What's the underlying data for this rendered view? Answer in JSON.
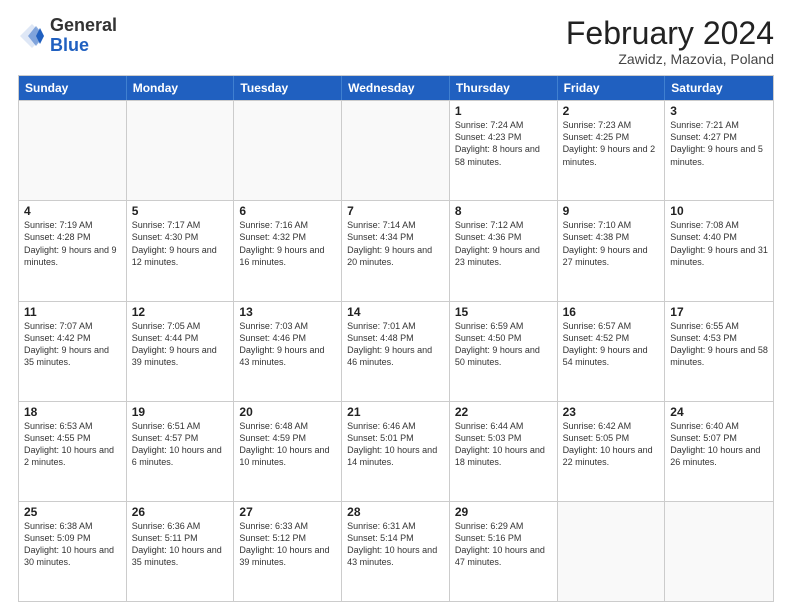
{
  "header": {
    "logo_general": "General",
    "logo_blue": "Blue",
    "title": "February 2024",
    "subtitle": "Zawidz, Mazovia, Poland"
  },
  "calendar": {
    "weekdays": [
      "Sunday",
      "Monday",
      "Tuesday",
      "Wednesday",
      "Thursday",
      "Friday",
      "Saturday"
    ],
    "rows": [
      [
        {
          "day": "",
          "empty": true
        },
        {
          "day": "",
          "empty": true
        },
        {
          "day": "",
          "empty": true
        },
        {
          "day": "",
          "empty": true
        },
        {
          "day": "1",
          "info": "Sunrise: 7:24 AM\nSunset: 4:23 PM\nDaylight: 8 hours\nand 58 minutes."
        },
        {
          "day": "2",
          "info": "Sunrise: 7:23 AM\nSunset: 4:25 PM\nDaylight: 9 hours\nand 2 minutes."
        },
        {
          "day": "3",
          "info": "Sunrise: 7:21 AM\nSunset: 4:27 PM\nDaylight: 9 hours\nand 5 minutes."
        }
      ],
      [
        {
          "day": "4",
          "info": "Sunrise: 7:19 AM\nSunset: 4:28 PM\nDaylight: 9 hours\nand 9 minutes."
        },
        {
          "day": "5",
          "info": "Sunrise: 7:17 AM\nSunset: 4:30 PM\nDaylight: 9 hours\nand 12 minutes."
        },
        {
          "day": "6",
          "info": "Sunrise: 7:16 AM\nSunset: 4:32 PM\nDaylight: 9 hours\nand 16 minutes."
        },
        {
          "day": "7",
          "info": "Sunrise: 7:14 AM\nSunset: 4:34 PM\nDaylight: 9 hours\nand 20 minutes."
        },
        {
          "day": "8",
          "info": "Sunrise: 7:12 AM\nSunset: 4:36 PM\nDaylight: 9 hours\nand 23 minutes."
        },
        {
          "day": "9",
          "info": "Sunrise: 7:10 AM\nSunset: 4:38 PM\nDaylight: 9 hours\nand 27 minutes."
        },
        {
          "day": "10",
          "info": "Sunrise: 7:08 AM\nSunset: 4:40 PM\nDaylight: 9 hours\nand 31 minutes."
        }
      ],
      [
        {
          "day": "11",
          "info": "Sunrise: 7:07 AM\nSunset: 4:42 PM\nDaylight: 9 hours\nand 35 minutes."
        },
        {
          "day": "12",
          "info": "Sunrise: 7:05 AM\nSunset: 4:44 PM\nDaylight: 9 hours\nand 39 minutes."
        },
        {
          "day": "13",
          "info": "Sunrise: 7:03 AM\nSunset: 4:46 PM\nDaylight: 9 hours\nand 43 minutes."
        },
        {
          "day": "14",
          "info": "Sunrise: 7:01 AM\nSunset: 4:48 PM\nDaylight: 9 hours\nand 46 minutes."
        },
        {
          "day": "15",
          "info": "Sunrise: 6:59 AM\nSunset: 4:50 PM\nDaylight: 9 hours\nand 50 minutes."
        },
        {
          "day": "16",
          "info": "Sunrise: 6:57 AM\nSunset: 4:52 PM\nDaylight: 9 hours\nand 54 minutes."
        },
        {
          "day": "17",
          "info": "Sunrise: 6:55 AM\nSunset: 4:53 PM\nDaylight: 9 hours\nand 58 minutes."
        }
      ],
      [
        {
          "day": "18",
          "info": "Sunrise: 6:53 AM\nSunset: 4:55 PM\nDaylight: 10 hours\nand 2 minutes."
        },
        {
          "day": "19",
          "info": "Sunrise: 6:51 AM\nSunset: 4:57 PM\nDaylight: 10 hours\nand 6 minutes."
        },
        {
          "day": "20",
          "info": "Sunrise: 6:48 AM\nSunset: 4:59 PM\nDaylight: 10 hours\nand 10 minutes."
        },
        {
          "day": "21",
          "info": "Sunrise: 6:46 AM\nSunset: 5:01 PM\nDaylight: 10 hours\nand 14 minutes."
        },
        {
          "day": "22",
          "info": "Sunrise: 6:44 AM\nSunset: 5:03 PM\nDaylight: 10 hours\nand 18 minutes."
        },
        {
          "day": "23",
          "info": "Sunrise: 6:42 AM\nSunset: 5:05 PM\nDaylight: 10 hours\nand 22 minutes."
        },
        {
          "day": "24",
          "info": "Sunrise: 6:40 AM\nSunset: 5:07 PM\nDaylight: 10 hours\nand 26 minutes."
        }
      ],
      [
        {
          "day": "25",
          "info": "Sunrise: 6:38 AM\nSunset: 5:09 PM\nDaylight: 10 hours\nand 30 minutes."
        },
        {
          "day": "26",
          "info": "Sunrise: 6:36 AM\nSunset: 5:11 PM\nDaylight: 10 hours\nand 35 minutes."
        },
        {
          "day": "27",
          "info": "Sunrise: 6:33 AM\nSunset: 5:12 PM\nDaylight: 10 hours\nand 39 minutes."
        },
        {
          "day": "28",
          "info": "Sunrise: 6:31 AM\nSunset: 5:14 PM\nDaylight: 10 hours\nand 43 minutes."
        },
        {
          "day": "29",
          "info": "Sunrise: 6:29 AM\nSunset: 5:16 PM\nDaylight: 10 hours\nand 47 minutes."
        },
        {
          "day": "",
          "empty": true
        },
        {
          "day": "",
          "empty": true
        }
      ]
    ]
  }
}
